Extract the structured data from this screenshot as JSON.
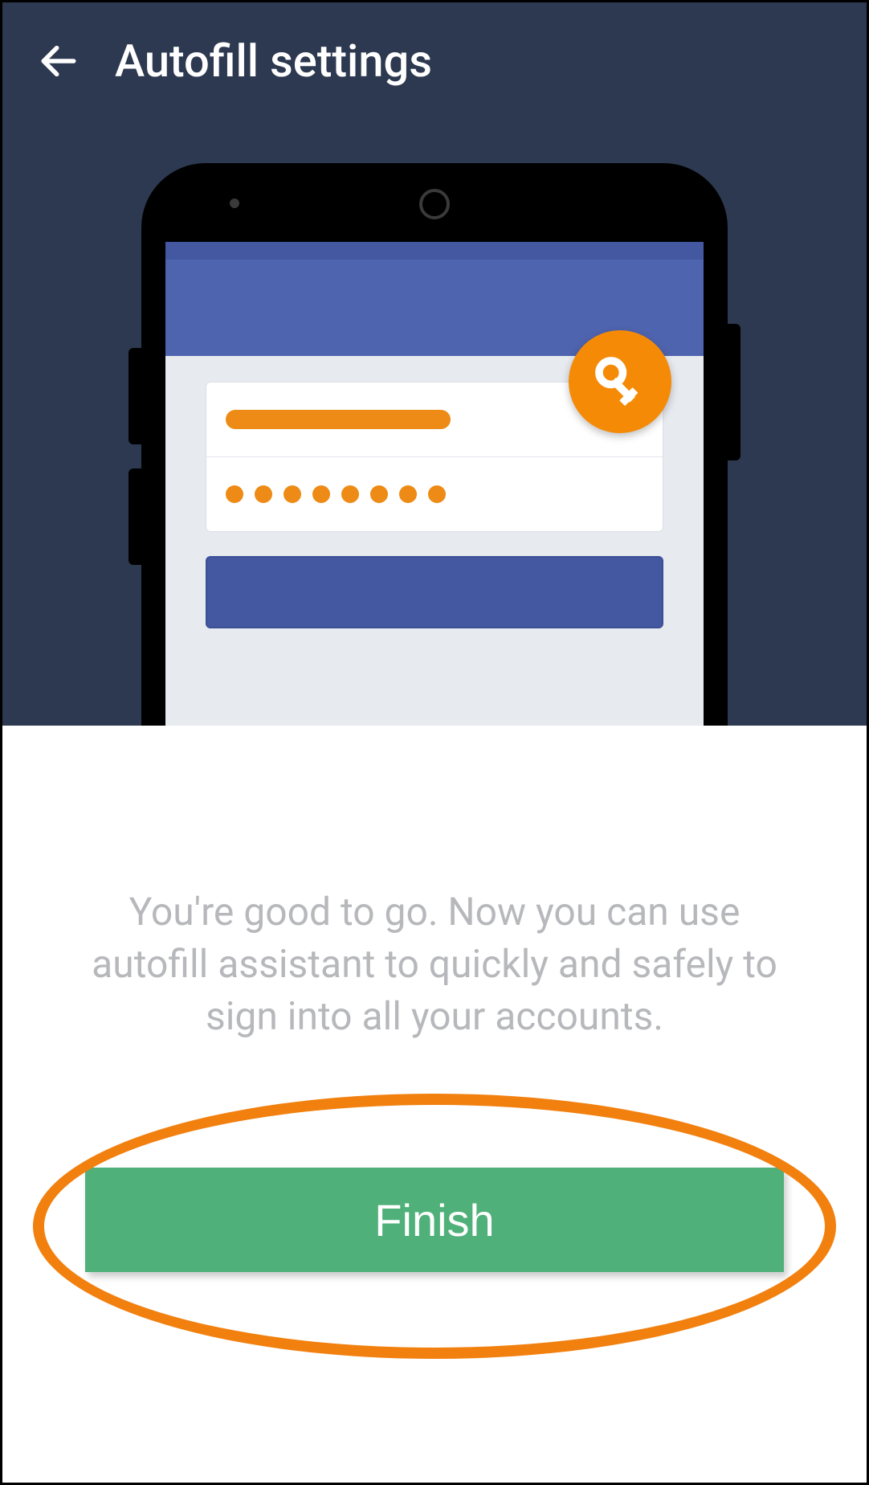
{
  "header": {
    "title": "Autofill settings",
    "back_icon": "arrow-left"
  },
  "illustration": {
    "fab_icon": "key",
    "username_placeholder_style": "filled-bar",
    "password_placeholder_style": "dots",
    "password_dot_count": 8,
    "login_button_style": "solid-blue"
  },
  "message": "You're good to go. Now you can use autofill assistant to quickly and safely to sign into all your accounts.",
  "cta": {
    "finish_label": "Finish"
  },
  "colors": {
    "background_dark": "#2d3950",
    "accent_orange": "#f1800f",
    "button_green": "#50b079",
    "brand_blue": "#4f64af"
  },
  "annotation": {
    "highlight_shape": "ellipse",
    "highlight_target": "finish-button"
  }
}
